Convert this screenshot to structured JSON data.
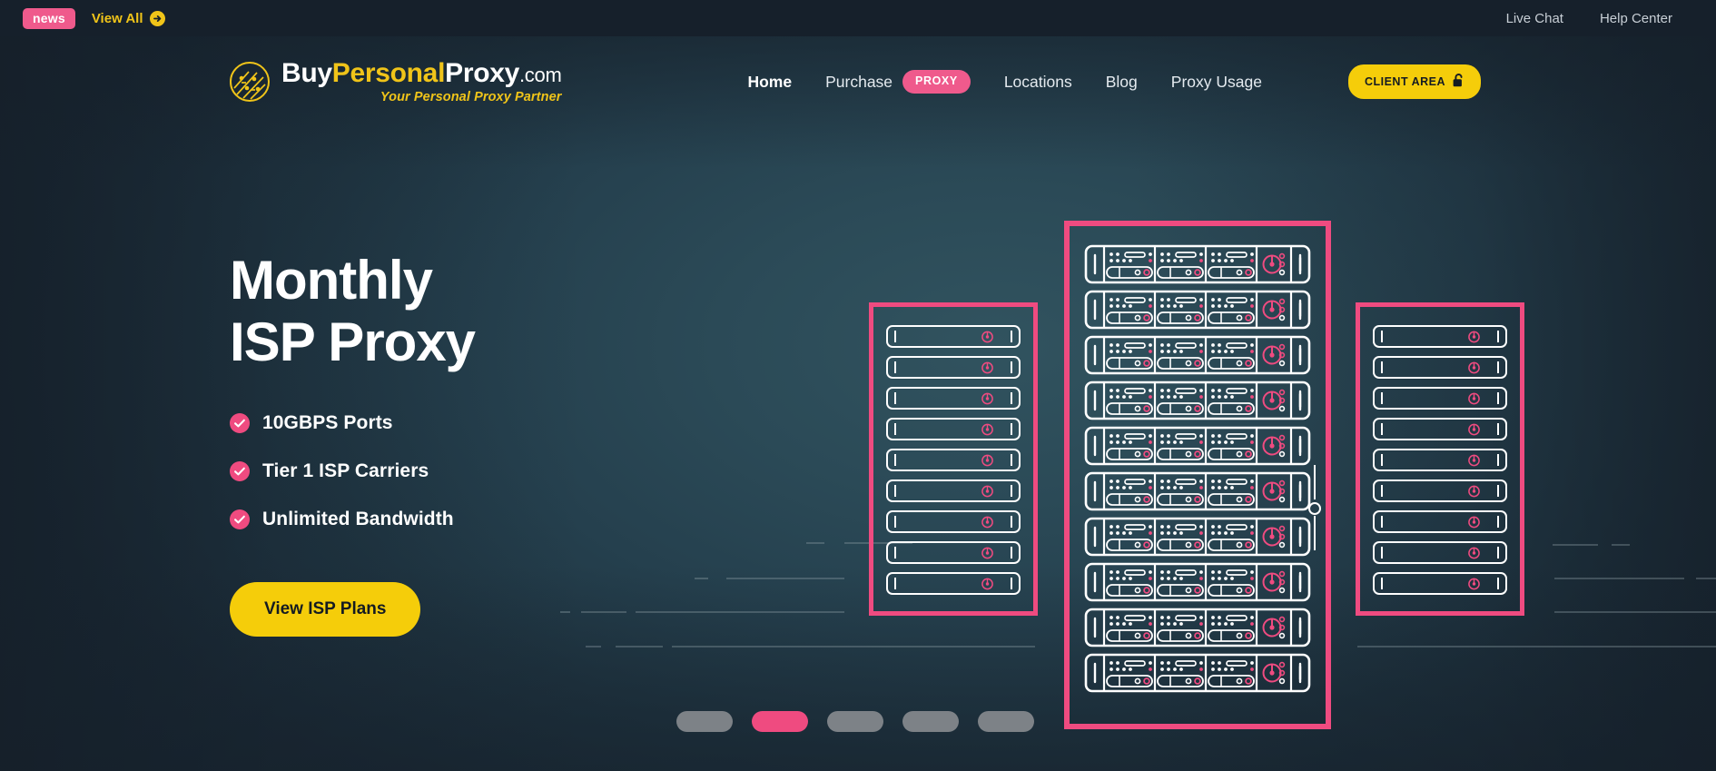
{
  "topbar": {
    "news_badge": "news",
    "view_all": "View All",
    "view_all_icon": "arrow-right-circle-icon",
    "links": [
      {
        "label": "Live Chat"
      },
      {
        "label": "Help Center"
      }
    ]
  },
  "logo": {
    "mark_icon": "circuit-globe-icon",
    "part_buy": "Buy",
    "part_personal": "Personal",
    "part_proxy": "Proxy",
    "part_tld": ".com",
    "tagline": "Your Personal Proxy Partner"
  },
  "nav": {
    "items": [
      {
        "label": "Home",
        "active": true
      },
      {
        "label": "Purchase",
        "badge": "PROXY",
        "active": false
      },
      {
        "label": "Locations",
        "active": false
      },
      {
        "label": "Blog",
        "active": false
      },
      {
        "label": "Proxy Usage",
        "active": false
      }
    ],
    "client_area": {
      "label": "CLIENT AREA",
      "icon": "unlock-padlock-icon"
    }
  },
  "hero": {
    "headline_line1": "Monthly",
    "headline_line2": "ISP Proxy",
    "features": [
      {
        "icon": "check-circle-icon",
        "label": "10GBPS Ports"
      },
      {
        "icon": "check-circle-icon",
        "label": "Tier 1 ISP Carriers"
      },
      {
        "icon": "check-circle-icon",
        "label": "Unlimited Bandwidth"
      }
    ],
    "cta_label": "View ISP Plans"
  },
  "carousel": {
    "slides": [
      {
        "active": false
      },
      {
        "active": true
      },
      {
        "active": false
      },
      {
        "active": false
      },
      {
        "active": false
      }
    ],
    "active_index": 2,
    "total": 5
  },
  "illustration": {
    "name": "server-rack-illustration",
    "racks": [
      {
        "name": "rack-left",
        "units": 9,
        "type": "slim"
      },
      {
        "name": "rack-center",
        "units": 10,
        "type": "detailed"
      },
      {
        "name": "rack-right",
        "units": 9,
        "type": "slim"
      }
    ]
  },
  "colors": {
    "accent_pink": "#ef4b80",
    "accent_yellow": "#f5cd0a",
    "background_dark": "#1b2836",
    "background_hero": "#2b4a57",
    "text_light": "#ffffff",
    "topbar": "#16202b"
  }
}
